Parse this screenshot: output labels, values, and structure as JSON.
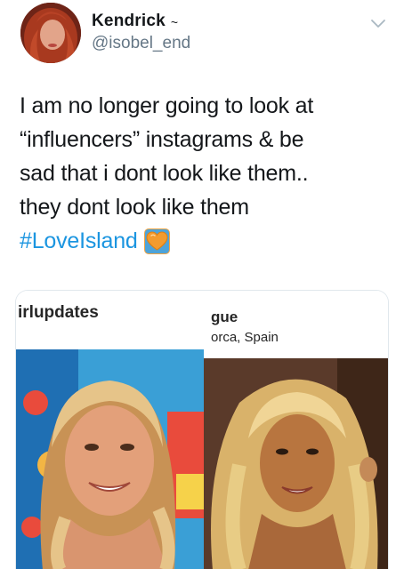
{
  "tweet": {
    "display_name": "Kendrick",
    "name_emoji": "~",
    "handle": "@isobel_end",
    "text_lines": [
      "I am no longer going to look at",
      "“influencers” instagrams & be",
      "sad that i dont look like them..",
      "they dont look like them"
    ],
    "hashtag": "#LoveIsland",
    "hashtag_color": "#1b95e0"
  },
  "media": {
    "left": {
      "username": "irlupdates"
    },
    "right": {
      "username": "gue",
      "location": "orca, Spain"
    }
  },
  "icons": {
    "avatar": "profile-photo",
    "menu": "chevron-down-icon",
    "emoji": "orange-heart-emoji"
  }
}
